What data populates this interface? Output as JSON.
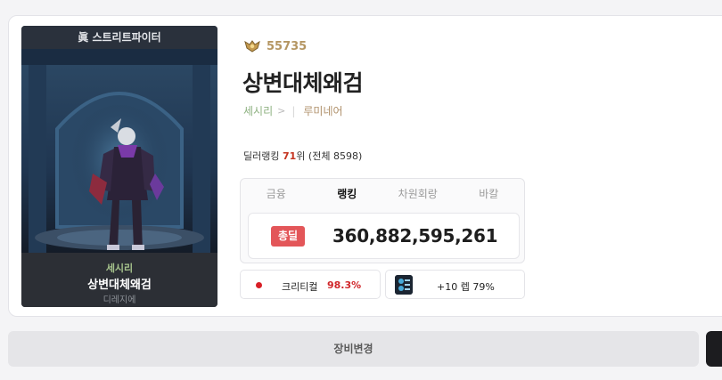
{
  "character": {
    "class_name": "眞 스트리트파이터",
    "job": "세시리",
    "name": "상변대체왜검",
    "server": "디레지에"
  },
  "profile": {
    "fame_icon": "fame-wings-icon",
    "fame_value": "55735",
    "name": "상변대체왜검",
    "job_link": "세시리",
    "job_chevron": ">",
    "guild": "루미네어"
  },
  "ranking": {
    "prefix": "딜러랭킹 ",
    "rank": "71",
    "suffix": "위 ",
    "total": "(전체 8598)"
  },
  "tabs": [
    {
      "label": "금융",
      "active": false
    },
    {
      "label": "랭킹",
      "active": true
    },
    {
      "label": "차원회랑",
      "active": false
    },
    {
      "label": "바칼",
      "active": false
    }
  ],
  "damage": {
    "badge": "총딜",
    "value": "360,882,595,261"
  },
  "stats": {
    "crit_label": "크리티컬",
    "crit_value": "98.3%",
    "level_label": "+10 렙 79%"
  },
  "actions": {
    "change_equipment": "장비변경"
  },
  "colors": {
    "accent_red": "#e35659",
    "fame_gold": "#b59662",
    "job_green": "#8fb282",
    "panel_dark": "#1d2530"
  }
}
